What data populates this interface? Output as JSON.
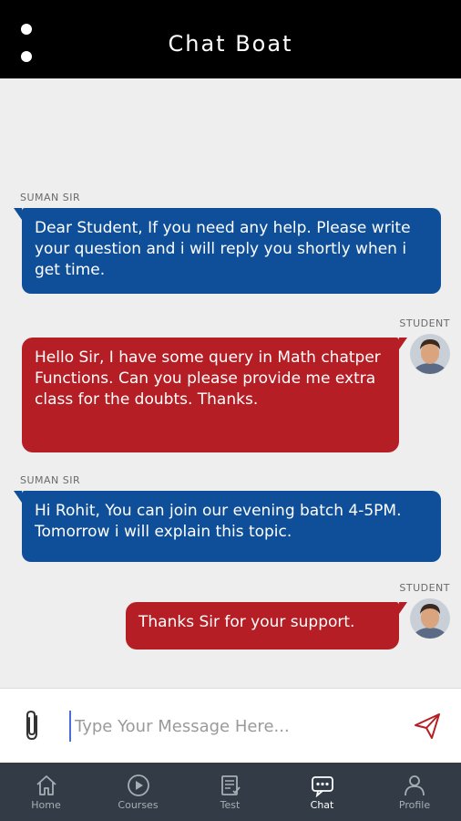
{
  "header": {
    "title": "Chat Boat",
    "menu_icon": "overflow-menu-icon"
  },
  "messages": [
    {
      "sender": "SUMAN SIR",
      "direction": "incoming",
      "text": "Dear Student, If you need any help. Please write your question and i will reply you shortly when i get time."
    },
    {
      "sender": "STUDENT",
      "direction": "outgoing",
      "text": "Hello Sir, I have some query in Math chatper Functions. Can you please provide me extra class for the doubts. Thanks."
    },
    {
      "sender": "SUMAN SIR",
      "direction": "incoming",
      "text": "Hi Rohit, You can join our evening batch 4-5PM. Tomorrow i will explain this topic."
    },
    {
      "sender": "STUDENT",
      "direction": "outgoing",
      "text": "Thanks Sir for your support."
    }
  ],
  "composer": {
    "placeholder": "Type Your Message Here...",
    "attach_icon": "paperclip-icon",
    "send_icon": "send-icon"
  },
  "tabs": [
    {
      "label": "Home",
      "icon": "home-icon"
    },
    {
      "label": "Courses",
      "icon": "play-icon"
    },
    {
      "label": "Test",
      "icon": "test-icon"
    },
    {
      "label": "Chat",
      "icon": "chat-icon",
      "active": true
    },
    {
      "label": "Profile",
      "icon": "profile-icon"
    }
  ],
  "colors": {
    "incoming_bubble": "#0f4f99",
    "outgoing_bubble": "#b51e24",
    "header": "#000000",
    "tabbar": "#333c46"
  }
}
